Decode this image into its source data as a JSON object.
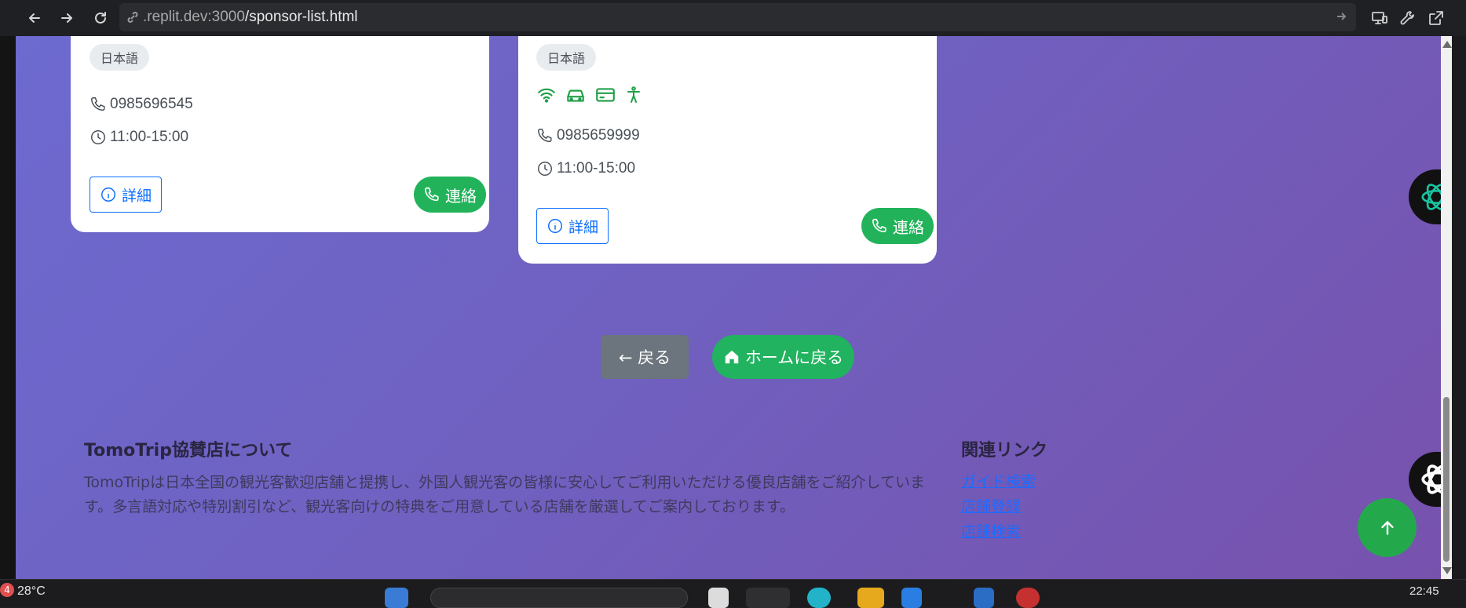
{
  "browser": {
    "url_host": ".replit.dev:3000",
    "url_path": "/sponsor-list.html"
  },
  "cards": [
    {
      "language": "日本語",
      "phone": "0985696545",
      "hours": "11:00-15:00",
      "detail_label": "詳細",
      "contact_label": "連絡",
      "amenities": []
    },
    {
      "language": "日本語",
      "phone": "0985659999",
      "hours": "11:00-15:00",
      "detail_label": "詳細",
      "contact_label": "連絡",
      "amenities": [
        "wifi-icon",
        "car-icon",
        "credit-card-icon",
        "accessibility-icon"
      ]
    }
  ],
  "nav": {
    "back_label": "← 戻る",
    "home_label": "ホームに戻る"
  },
  "footer": {
    "about_title": "TomoTrip協賛店について",
    "about_text": "TomoTripは日本全国の観光客歓迎店舗と提携し、外国人観光客の皆様に安心してご利用いただける優良店舗をご紹介しています。多言語対応や特別割引など、観光客向けの特典をご用意している店舗を厳選してご案内しております。",
    "links_title": "関連リンク",
    "links": [
      "ガイド検索",
      "店舗登録",
      "店舗検索"
    ]
  },
  "taskbar": {
    "weather": "28°C",
    "notification_count": "4",
    "time": "22:45"
  },
  "colors": {
    "accent_green": "#22b35a",
    "primary_blue": "#0d6efd",
    "background_purple": "#6f62c2"
  }
}
